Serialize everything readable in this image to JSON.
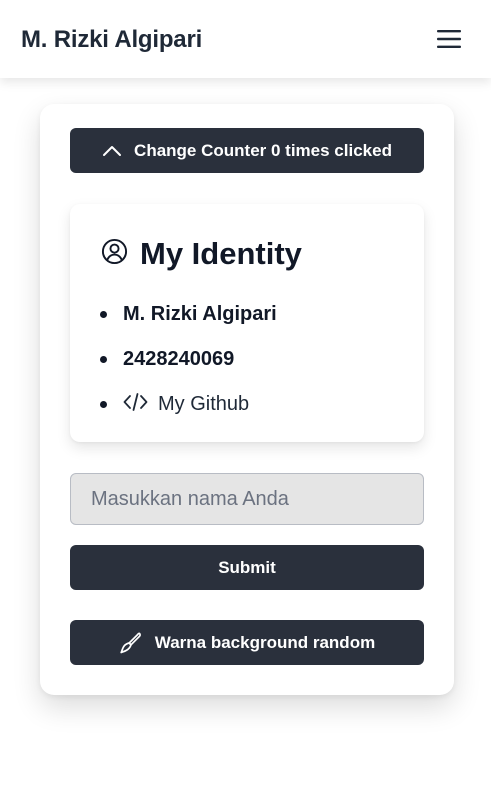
{
  "navbar": {
    "brand": "M. Rizki Algipari",
    "menu_icon": "hamburger-menu-icon"
  },
  "counter_button": {
    "icon": "chevron-up-icon",
    "label": "Change Counter 0 times clicked"
  },
  "identity": {
    "icon": "user-circle-icon",
    "title": "My Identity",
    "items": [
      {
        "text": "M. Rizki Algipari"
      },
      {
        "text": "2428240069"
      },
      {
        "icon": "code-icon",
        "text": "My Github"
      }
    ]
  },
  "name_input": {
    "value": "",
    "placeholder": "Masukkan nama Anda"
  },
  "submit_button": {
    "label": "Submit"
  },
  "random_button": {
    "icon": "paint-brush-icon",
    "label": "Warna background random"
  },
  "colors": {
    "button_background": "#2a303c",
    "button_text": "#ffffff",
    "input_background": "#e5e5e5",
    "text_primary": "#111827"
  }
}
